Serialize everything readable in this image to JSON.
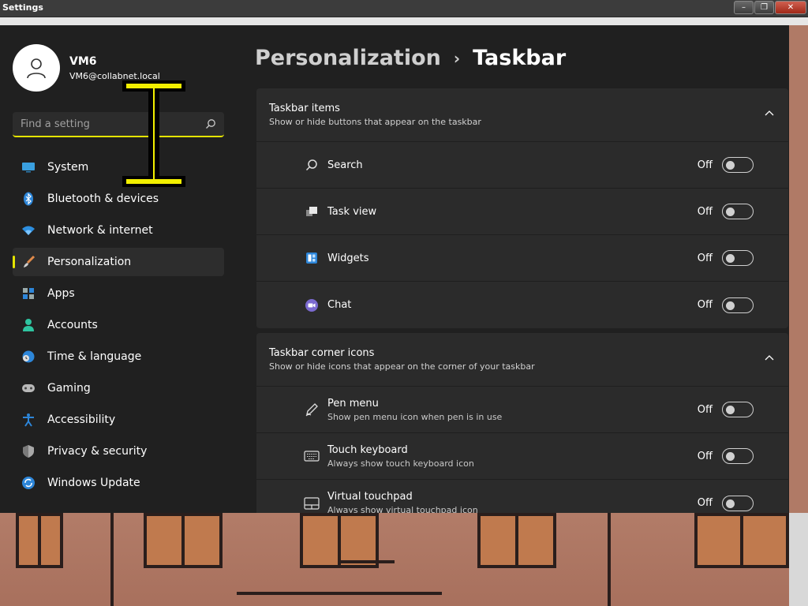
{
  "window": {
    "title": "Settings",
    "controls": {
      "minimize": "–",
      "maximize": "❐",
      "close": "✕"
    }
  },
  "profile": {
    "name": "VM6",
    "email": "VM6@collabnet.local"
  },
  "search": {
    "placeholder": "Find a setting"
  },
  "sidebar": {
    "items": [
      {
        "label": "System",
        "icon": "monitor-icon"
      },
      {
        "label": "Bluetooth & devices",
        "icon": "bluetooth-icon"
      },
      {
        "label": "Network & internet",
        "icon": "wifi-icon"
      },
      {
        "label": "Personalization",
        "icon": "brush-icon",
        "active": true
      },
      {
        "label": "Apps",
        "icon": "apps-icon"
      },
      {
        "label": "Accounts",
        "icon": "person-icon"
      },
      {
        "label": "Time & language",
        "icon": "clock-globe-icon"
      },
      {
        "label": "Gaming",
        "icon": "gamepad-icon"
      },
      {
        "label": "Accessibility",
        "icon": "accessibility-icon"
      },
      {
        "label": "Privacy & security",
        "icon": "shield-icon"
      },
      {
        "label": "Windows Update",
        "icon": "update-icon"
      }
    ]
  },
  "breadcrumb": {
    "parent": "Personalization",
    "separator": "›",
    "current": "Taskbar"
  },
  "groups": [
    {
      "title": "Taskbar items",
      "subtitle": "Show or hide buttons that appear on the taskbar",
      "items": [
        {
          "label": "Search",
          "state": "Off",
          "icon": "search-icon"
        },
        {
          "label": "Task view",
          "state": "Off",
          "icon": "task-view-icon"
        },
        {
          "label": "Widgets",
          "state": "Off",
          "icon": "widgets-icon"
        },
        {
          "label": "Chat",
          "state": "Off",
          "icon": "chat-icon"
        }
      ]
    },
    {
      "title": "Taskbar corner icons",
      "subtitle": "Show or hide icons that appear on the corner of your taskbar",
      "items": [
        {
          "label": "Pen menu",
          "sub": "Show pen menu icon when pen is in use",
          "state": "Off",
          "icon": "pen-icon"
        },
        {
          "label": "Touch keyboard",
          "sub": "Always show touch keyboard icon",
          "state": "Off",
          "icon": "keyboard-icon"
        },
        {
          "label": "Virtual touchpad",
          "sub": "Always show virtual touchpad icon",
          "state": "Off",
          "icon": "touchpad-icon"
        }
      ]
    }
  ],
  "colors": {
    "accent": "#e5e400",
    "background": "#202020",
    "card": "#2b2b2b",
    "text": "#ffffff"
  }
}
